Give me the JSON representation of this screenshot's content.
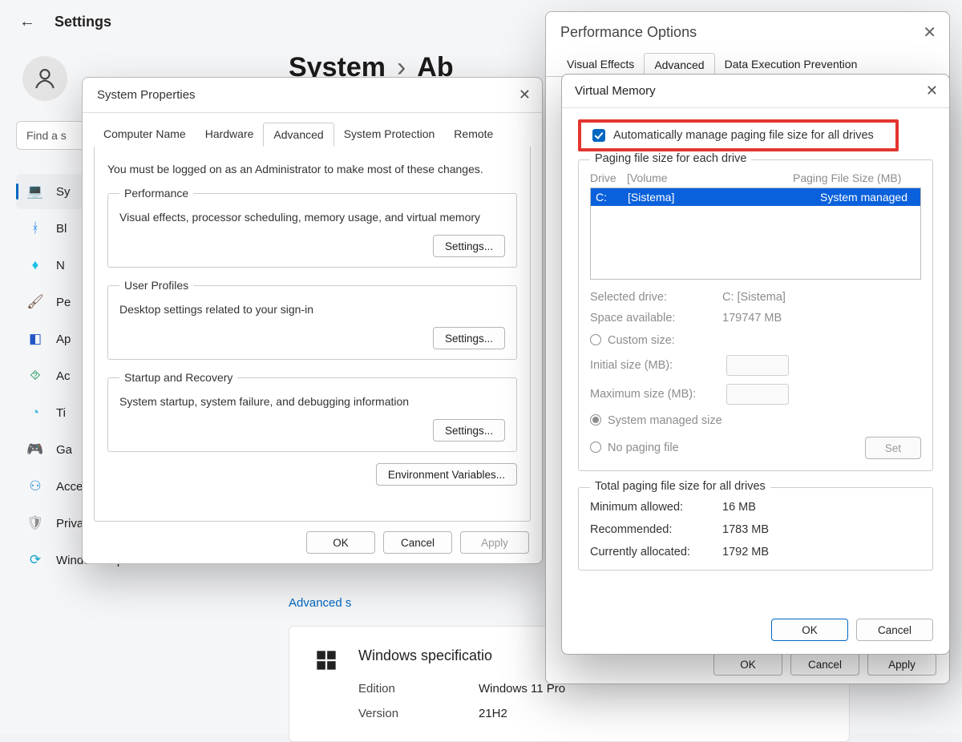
{
  "settings": {
    "back_glyph": "←",
    "title": "Settings",
    "search_placeholder": "Find a s",
    "wincontrols": {
      "min": "—",
      "max": "▢",
      "close": "✕"
    },
    "nav": [
      {
        "icon": "💻",
        "label": "Sy",
        "color": "#3d7dd6"
      },
      {
        "icon": "ᚼ",
        "label": "Bl",
        "color": "#2e8de6"
      },
      {
        "icon": "♦",
        "label": "N",
        "color": "#18c0e6"
      },
      {
        "icon": "🖌",
        "label": "Pe",
        "color": "#6a4c3a"
      },
      {
        "icon": "◧",
        "label": "Ap",
        "color": "#2356c4"
      },
      {
        "icon": "⯑",
        "label": "Ac",
        "color": "#2a9d60"
      },
      {
        "icon": "◔",
        "label": "Ti",
        "color": "#44b3e2"
      },
      {
        "icon": "🎮",
        "label": "Ga",
        "color": "#8a8a8a"
      },
      {
        "icon": "⚇",
        "label": "Accessibility",
        "color": "#1f8ad6"
      },
      {
        "icon": "🛡",
        "label": "Privacy & security",
        "color": "#8f8f8f"
      },
      {
        "icon": "⟳",
        "label": "Windows Update",
        "color": "#17a3c9"
      }
    ],
    "crumb": {
      "a": "System",
      "sep": "›",
      "b": "Ab"
    },
    "advanced_link": "Advanced s",
    "spec": {
      "title": "Windows specificatio",
      "rows": [
        {
          "k": "Edition",
          "v": "Windows 11 Pro"
        },
        {
          "k": "Version",
          "v": "21H2"
        }
      ]
    }
  },
  "sysprops": {
    "title": "System Properties",
    "tabs": [
      "Computer Name",
      "Hardware",
      "Advanced",
      "System Protection",
      "Remote"
    ],
    "active_tab": 2,
    "note": "You must be logged on as an Administrator to make most of these changes.",
    "groups": [
      {
        "legend": "Performance",
        "desc": "Visual effects, processor scheduling, memory usage, and virtual memory",
        "btn": "Settings..."
      },
      {
        "legend": "User Profiles",
        "desc": "Desktop settings related to your sign-in",
        "btn": "Settings..."
      },
      {
        "legend": "Startup and Recovery",
        "desc": "System startup, system failure, and debugging information",
        "btn": "Settings..."
      }
    ],
    "env_btn": "Environment Variables...",
    "footer": {
      "ok": "OK",
      "cancel": "Cancel",
      "apply": "Apply"
    }
  },
  "perf": {
    "title": "Performance Options",
    "tabs": [
      "Visual Effects",
      "Advanced",
      "Data Execution Prevention"
    ],
    "active_tab": 1,
    "footer": {
      "ok": "OK",
      "cancel": "Cancel",
      "apply": "Apply"
    }
  },
  "vmem": {
    "title": "Virtual Memory",
    "auto_label": "Automatically manage paging file size for all drives",
    "group_legend": "Paging file size for each drive",
    "headers": {
      "drive": "Drive",
      "volume": "[Volume",
      "psize": "Paging File Size (MB)"
    },
    "row": {
      "drive": "C:",
      "volume": "[Sistema]",
      "psize": "System managed"
    },
    "selected_drive_label": "Selected drive:",
    "selected_drive_val": "C:  [Sistema]",
    "space_label": "Space available:",
    "space_val": "179747 MB",
    "custom_label": "Custom size:",
    "initial_label": "Initial size (MB):",
    "max_label": "Maximum size (MB):",
    "sys_managed_label": "System managed size",
    "no_paging_label": "No paging file",
    "set_btn": "Set",
    "totals_legend": "Total paging file size for all drives",
    "totals": [
      {
        "k": "Minimum allowed:",
        "v": "16 MB"
      },
      {
        "k": "Recommended:",
        "v": "1783 MB"
      },
      {
        "k": "Currently allocated:",
        "v": "1792 MB"
      }
    ],
    "footer": {
      "ok": "OK",
      "cancel": "Cancel"
    }
  }
}
